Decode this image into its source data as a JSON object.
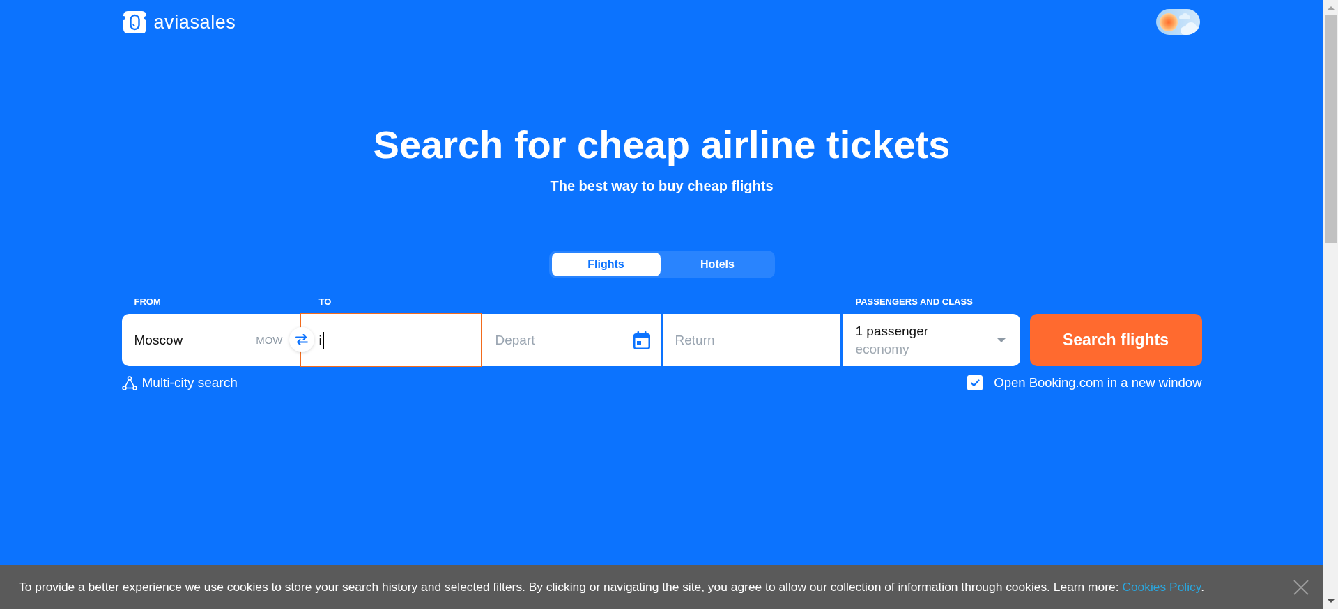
{
  "header": {
    "logo": "aviasales",
    "theme_toggle": {
      "night_mode": false
    }
  },
  "hero": {
    "title": "Search for cheap airline tickets",
    "subtitle": "The best way to buy cheap flights"
  },
  "tabs": [
    {
      "label": "Flights",
      "selected": true
    },
    {
      "label": "Hotels",
      "selected": false
    }
  ],
  "search_form": {
    "fields": [
      {
        "kind": "origin",
        "label": "FROM",
        "value": "Moscow",
        "code": "MOW",
        "focused": false
      },
      {
        "kind": "destination",
        "label": "TO",
        "value": "i",
        "focused": true
      },
      {
        "kind": "departure",
        "placeholder": "Depart",
        "focused": false
      },
      {
        "kind": "return",
        "placeholder": "Return",
        "focused": false
      },
      {
        "kind": "passengers",
        "label": "PASSENGERS AND CLASS",
        "value": "1 passenger",
        "travel_class": "economy",
        "focused": false
      }
    ],
    "search_button": "Search flights",
    "multi_city_link": "Multi-city search",
    "open_booking": {
      "label": "Open Booking.com in a new window",
      "checked": true
    }
  },
  "cookie_banner": {
    "text": "To provide a better experience we use cookies to store your search history and selected filters. By clicking or navigating the site, you agree to allow our collection of information through cookies. Learn more:",
    "link": "Cookies Policy",
    "suffix": "."
  }
}
